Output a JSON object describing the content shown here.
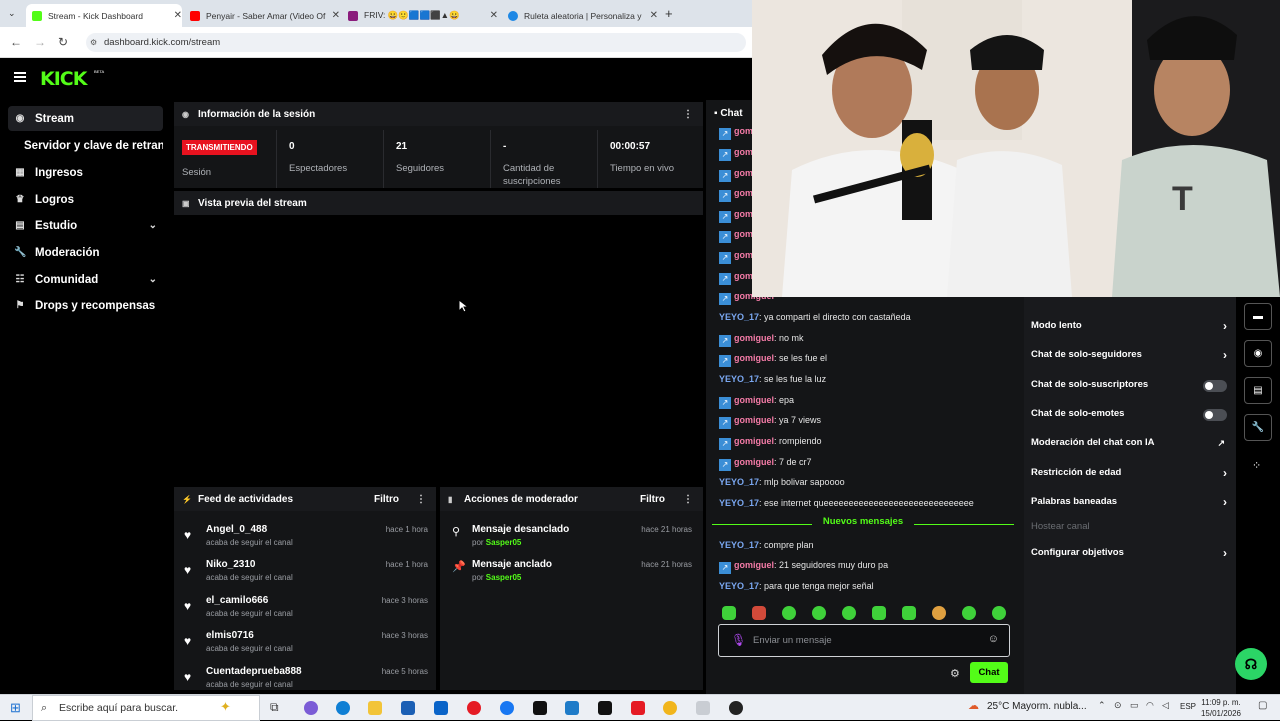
{
  "browser": {
    "tabs": [
      {
        "title": "Stream - Kick Dashboard",
        "color": "#53fc18"
      },
      {
        "title": "Penyair - Saber Amar (Video Of",
        "color": "#ff0000"
      },
      {
        "title": "FRIV: 😀🙂🟦🟦⬛▲😀",
        "color": "#8a1c7c"
      },
      {
        "title": "Ruleta aleatoria | Personaliza y",
        "color": "#1e88e5"
      }
    ],
    "url": "dashboard.kick.com/stream"
  },
  "header": {
    "logo": "KICK",
    "beta": "BETA"
  },
  "sidebar": {
    "items": [
      {
        "label": "Stream",
        "icon": "broadcast-icon"
      },
      {
        "label": "Servidor y clave de retransmisión"
      },
      {
        "label": "Ingresos",
        "icon": "chart-icon"
      },
      {
        "label": "Logros",
        "icon": "trophy-icon"
      },
      {
        "label": "Estudio",
        "icon": "studio-icon"
      },
      {
        "label": "Moderación",
        "icon": "wrench-icon"
      },
      {
        "label": "Comunidad",
        "icon": "community-icon"
      },
      {
        "label": "Drops y recompensas",
        "icon": "drops-icon"
      }
    ]
  },
  "session": {
    "title": "Información de la sesión",
    "live_badge": "TRANSMITIENDO",
    "live_label": "Sesión",
    "stats": [
      {
        "value": "0",
        "label": "Espectadores"
      },
      {
        "value": "21",
        "label": "Seguidores"
      },
      {
        "value": "-",
        "label": "Cantidad de suscripciones"
      },
      {
        "value": "00:00:57",
        "label": "Tiempo en vivo"
      }
    ]
  },
  "preview": {
    "title": "Vista previa del stream"
  },
  "feed": {
    "title": "Feed de actividades",
    "filter": "Filtro",
    "items": [
      {
        "name": "Angel_0_488",
        "sub": "acaba de seguir el canal",
        "time": "hace 1 hora"
      },
      {
        "name": "Niko_2310",
        "sub": "acaba de seguir el canal",
        "time": "hace 1 hora"
      },
      {
        "name": "el_camilo666",
        "sub": "acaba de seguir el canal",
        "time": "hace 3 horas"
      },
      {
        "name": "elmis0716",
        "sub": "acaba de seguir el canal",
        "time": "hace 3 horas"
      },
      {
        "name": "Cuentadeprueba888",
        "sub": "acaba de seguir el canal",
        "time": "hace 5 horas"
      }
    ]
  },
  "modactions": {
    "title": "Acciones de moderador",
    "filter": "Filtro",
    "items": [
      {
        "name": "Mensaje desanclado",
        "by": "por",
        "user": "Sasper05",
        "time": "hace 21 horas"
      },
      {
        "name": "Mensaje anclado",
        "by": "por",
        "user": "Sasper05",
        "time": "hace 21 horas"
      }
    ]
  },
  "chat": {
    "title": "Chat",
    "earlier_user": "gomiguel",
    "messages": [
      {
        "user": "YEYO_17",
        "text": ": ya comparti el directo con castañeda",
        "kind": "u2"
      },
      {
        "user": "gomiguel",
        "text": ": no mk",
        "kind": "u1"
      },
      {
        "user": "gomiguel",
        "text": ": se les fue el",
        "kind": "u1"
      },
      {
        "user": "YEYO_17",
        "text": ": se les fue la luz",
        "kind": "u2"
      },
      {
        "user": "gomiguel",
        "text": ": epa",
        "kind": "u1"
      },
      {
        "user": "gomiguel",
        "text": ": ya 7 views",
        "kind": "u1"
      },
      {
        "user": "gomiguel",
        "text": ": rompiendo",
        "kind": "u1"
      },
      {
        "user": "gomiguel",
        "text": ": 7 de cr7",
        "kind": "u1"
      },
      {
        "user": "YEYO_17",
        "text": ": mlp bolivar sapoooo",
        "kind": "u2"
      },
      {
        "user": "YEYO_17",
        "text": ": ese internet queeeeeeeeeeeeeeeeeeeeeeeeeeeeee",
        "kind": "u2"
      }
    ],
    "new_label": "Nuevos mensajes",
    "new_messages": [
      {
        "user": "YEYO_17",
        "text": ": compre plan",
        "kind": "u2"
      },
      {
        "user": "gomiguel",
        "text": ": 21 seguidores muy duro pa",
        "kind": "u1"
      },
      {
        "user": "YEYO_17",
        "text": ": para que tenga mejor señal",
        "kind": "u2"
      }
    ],
    "input_placeholder": "Enviar un mensaje",
    "send_label": "Chat"
  },
  "chat_settings": {
    "items": [
      {
        "label": "Modo lento",
        "control": "arrow"
      },
      {
        "label": "Chat de solo-seguidores",
        "control": "arrow"
      },
      {
        "label": "Chat de solo-suscriptores",
        "control": "toggle"
      },
      {
        "label": "Chat de solo-emotes",
        "control": "toggle"
      },
      {
        "label": "Moderación del chat con IA",
        "control": "external"
      },
      {
        "label": "Restricción de edad",
        "control": "arrow"
      },
      {
        "label": "Palabras baneadas",
        "control": "arrow"
      },
      {
        "label": "Hostear canal",
        "control": "disabled"
      },
      {
        "label": "Configurar objetivos",
        "control": "arrow"
      }
    ]
  },
  "taskbar": {
    "search_placeholder": "Escribe aquí para buscar.",
    "weather": "25°C  Mayorm. nubla...",
    "lang": "ESP",
    "time": "11:09 p. m.",
    "date": "15/01/2026"
  }
}
